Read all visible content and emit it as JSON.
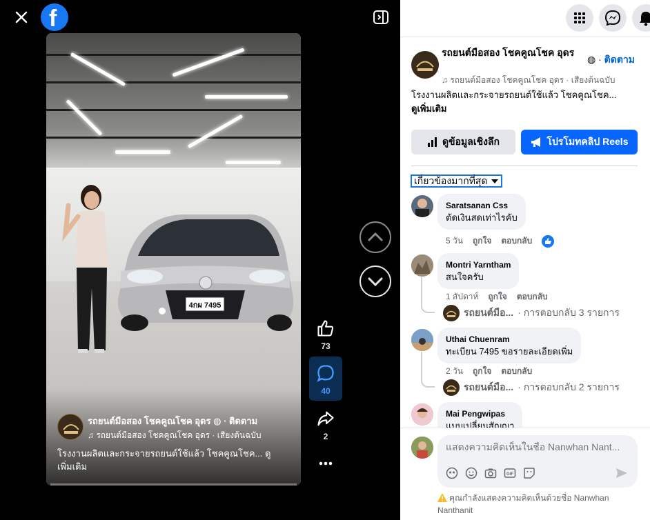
{
  "video": {
    "page_name": "รถยนต์มือสอง โชคคูณโชค อุดร",
    "follow_label": "ติดตาม",
    "audio_line": "รถยนต์มือสอง โชคคูณโชค อุดร · เสียงต้นฉบับ",
    "description": "โรงงานผลิตและกระจายรถยนต์ใช้แล้ว โชคคูณโชค... ดู",
    "see_more": "เพิ่มเติม",
    "plate": "4กผ 7495"
  },
  "actions": {
    "like_count": "73",
    "comment_count": "40",
    "share_count": "2"
  },
  "panel": {
    "page_name": "รถยนต์มือสอง โชคคูณโชค อุดร",
    "follow_label": "ติดตาม",
    "audio_line": "รถยนต์มือสอง โชคคูณโชค อุดร · เสียงต้นฉบับ",
    "description": "โรงงานผลิตและกระจายรถยนต์ใช้แล้ว โชคคูณโชค...",
    "see_more": "ดูเพิ่มเติม",
    "insights_label": "ดูข้อมูลเชิงลึก",
    "promote_label": "โปรโมทคลิป Reels",
    "sort_label": "เกี่ยวข้องมากที่สุด"
  },
  "comments": [
    {
      "name": "Saratsanan Css",
      "text": "ตัดเงินสดเท่าไรคับ",
      "time": "5 วัน",
      "like": "ถูกใจ",
      "reply": "ตอบกลับ"
    },
    {
      "name": "Montri Yarntham",
      "text": "สนใจครับ",
      "time": "1 สัปดาห์",
      "like": "ถูกใจ",
      "reply": "ตอบกลับ",
      "reply_author": "รถยนต์มือ...",
      "reply_summary": "· การตอบกลับ 3 รายการ"
    },
    {
      "name": "Uthai Chuenram",
      "text": "ทะเบียน 7495 ขอรายละเอียดเพิ่ม",
      "time": "2 วัน",
      "like": "ถูกใจ",
      "reply": "ตอบกลับ",
      "reply_author": "รถยนต์มือ...",
      "reply_summary": "· การตอบกลับ 2 รายการ"
    },
    {
      "name": "Mai Pengwipas",
      "text": "แบบเปลี่ยนสัญญา"
    }
  ],
  "composer": {
    "placeholder": "แสดงความคิดเห็นในชื่อ Nanwhan Nant...",
    "notice": "คุณกำลังแสดงความคิดเห็นด้วยชื่อ Nanwhan Nanthanit"
  },
  "colors": {
    "brand": "#1877f2",
    "primary_button": "#0866ff",
    "link": "#0064d1",
    "active_action": "#4599ff"
  }
}
